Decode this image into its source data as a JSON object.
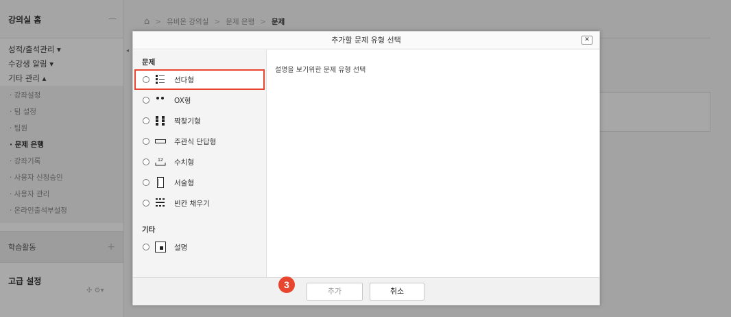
{
  "sidebar": {
    "header": "강의실 홈",
    "header_toggle": "—",
    "groups": [
      {
        "label": "성적/출석관리 ▾"
      },
      {
        "label": "수강생 알림 ▾"
      },
      {
        "label": "기타 관리 ▴"
      }
    ],
    "subitems": [
      {
        "label": "· 강좌설정"
      },
      {
        "label": "· 팀 설정"
      },
      {
        "label": "· 팀원"
      },
      {
        "label": "· 문제 은행"
      },
      {
        "label": "· 강좌기록"
      },
      {
        "label": "· 사용자 신청승인"
      },
      {
        "label": "· 사용자 관리"
      },
      {
        "label": "· 온라인출석부설정"
      }
    ],
    "activity": "학습활동",
    "activity_add": "+",
    "advanced": "고급 설정",
    "advanced_tools": "✣ ⚙▾",
    "collapse": "◂"
  },
  "breadcrumb": {
    "home_icon": "⌂",
    "sep": ">",
    "items": [
      "유비온 강의실",
      "문제 은행",
      "문제"
    ]
  },
  "dialog": {
    "title": "추가할 문제 유형 선택",
    "close": "✕",
    "description": "설명을 보기위한 문제 유형 선택",
    "category_question": "문제",
    "category_other": "기타",
    "options": [
      {
        "label": "선다형",
        "icon": "multiple-choice-icon"
      },
      {
        "label": "OX형",
        "icon": "true-false-icon"
      },
      {
        "label": "짝찾기형",
        "icon": "matching-icon"
      },
      {
        "label": "주관식 단답형",
        "icon": "short-answer-icon"
      },
      {
        "label": "수치형",
        "icon": "numerical-icon"
      },
      {
        "label": "서술형",
        "icon": "essay-icon"
      },
      {
        "label": "빈칸 채우기",
        "icon": "fill-blank-icon"
      }
    ],
    "other_options": [
      {
        "label": "설명",
        "icon": "description-icon"
      }
    ],
    "selected_highlight": "선다형",
    "add_button": "추가",
    "cancel_button": "취소"
  },
  "step_badge": "3",
  "colors": {
    "highlight": "#e8452e",
    "badge": "#e8452e"
  }
}
